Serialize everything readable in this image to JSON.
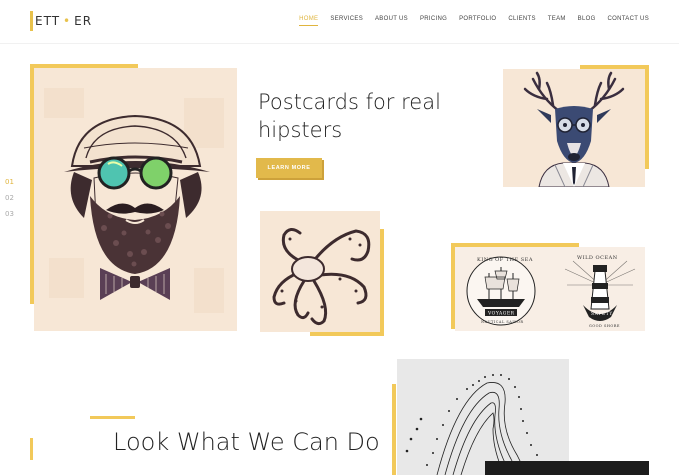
{
  "brand": {
    "logo_text_left": "ETT",
    "logo_text_right": "ER",
    "accent": "#e8c24c"
  },
  "nav": {
    "items": [
      {
        "label": "HOME",
        "active": true
      },
      {
        "label": "SERVICES",
        "active": false
      },
      {
        "label": "ABOUT US",
        "active": false
      },
      {
        "label": "PRICING",
        "active": false
      },
      {
        "label": "PORTFOLIO",
        "active": false
      },
      {
        "label": "CLIENTS",
        "active": false
      },
      {
        "label": "TEAM",
        "active": false
      },
      {
        "label": "BLOG",
        "active": false
      },
      {
        "label": "CONTACT US",
        "active": false
      }
    ]
  },
  "slider": {
    "numbers": [
      "01",
      "02",
      "03"
    ],
    "active_index": 0
  },
  "hero": {
    "headline_line1": "Postcards for real",
    "headline_line2": "hipsters",
    "button_label": "LEARN MORE"
  },
  "cards": {
    "hipster": {
      "icon": "hipster-portrait-icon"
    },
    "deer": {
      "icon": "deer-portrait-icon"
    },
    "octopus": {
      "icon": "octopus-icon"
    },
    "ships": {
      "icon": "ship-and-lighthouse-icon",
      "left_arc_text": "KING OF THE SEA",
      "left_banner_text": "VOYAGER",
      "left_bottom_text": "NAUTICAL SAILOR",
      "right_arc_text": "WILD OCEAN",
      "right_banner_text": "SAFETY",
      "right_bottom_text": "GOOD SHORE"
    },
    "abstract": {
      "icon": "abstract-dot-pattern-icon"
    }
  },
  "section2": {
    "title": "Look What We Can Do"
  }
}
